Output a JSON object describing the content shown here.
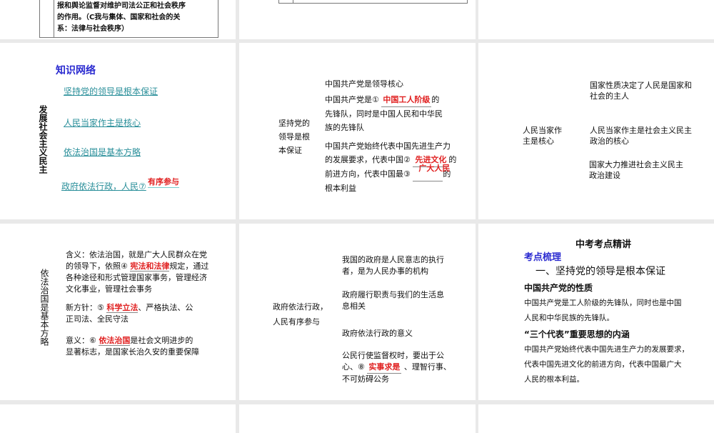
{
  "slides": {
    "s0a": {
      "lines": [
        "报和舆论监督对维护司法公正和社会秩序",
        "的作用。（C我与集体、国家和社会的关",
        "系：法律与社会秩序）"
      ]
    },
    "s1": {
      "title": "知识网络",
      "side": "发展社会主义民主",
      "links": [
        "坚持党的领导是根本保证",
        "人民当家作主是核心",
        "依法治国是基本方略",
        "政府依法行政，人民⑦"
      ],
      "answer7": "有序参与"
    },
    "s2": {
      "left": [
        "坚持党的",
        "领导是根",
        "本保证"
      ],
      "l1": "中国共产党是领导核心",
      "l2a": "中国共产党是①",
      "a1": "中国工人阶级",
      "l2b": "的",
      "l3": "先锋队，同时是中国人民和中华民",
      "l4": "族的先锋队",
      "l5": "中国共产党始终代表中国先进生产力",
      "l6a": "的发展要求，代表中国②",
      "a2": "先进文化",
      "l6b": "的",
      "l7a": "前进方向，代表中国最③",
      "a3": "广大人民",
      "l7b": "的",
      "l8": "根本利益"
    },
    "s3": {
      "left": [
        "人民当家作",
        "主是核心"
      ],
      "r1": [
        "国家性质决定了人民是国家和",
        "社会的主人"
      ],
      "r2": [
        "人民当家作主是社会主义民主",
        "政治的核心"
      ],
      "r3": [
        "国家大力推进社会主义民主",
        "政治建设"
      ]
    },
    "s4": {
      "side": "依法治国是基本方略",
      "m1": "含义：依法治国，就是广大人民群众在党",
      "m2a": "的领导下，依照④",
      "a4": "宪法和法律",
      "m2b": "规定，通过",
      "m3": "各种途径和形式管理国家事务，管理经济",
      "m4": "文化事业，管理社会事务",
      "n1a": "新方针：⑤",
      "a5": "科学立法",
      "n1b": "、严格执法、公",
      "n2": "正司法、全民守法",
      "y1a": "意义：⑥",
      "a6": "依法治国",
      "y1b": "是社会文明进步的",
      "y2": "显著标志，是国家长治久安的重要保障"
    },
    "s5": {
      "left": [
        "政府依法行政，",
        "人民有序参与"
      ],
      "r1": [
        "我国的政府是人民意志的执行",
        "者，是为人民办事的机构"
      ],
      "r2": [
        "政府履行职责与我们的生活息",
        "息相关"
      ],
      "r3": "政府依法行政的意义",
      "r4a": "公民行使监督权时，要出于公",
      "r4b": "心、⑧",
      "a8": "实事求是",
      "r4c": "、理智行事、",
      "r4d": "不可妨碍公务"
    },
    "s6": {
      "title": "中考考点精讲",
      "sub": "考点梳理",
      "heading": "一、坚持党的领导是根本保证",
      "h1": "中国共产党的性质",
      "p1": [
        "中国共产党是工人阶级的先锋队，同时也是中国",
        "人民和中华民族的先锋队。"
      ],
      "h2": "“三个代表”重要思想的内涵",
      "p2": [
        "中国共产党始终代表中国先进生产力的发展要求，",
        "代表中国先进文化的前进方向，代表中国最广大",
        "人民的根本利益。"
      ]
    }
  },
  "colors": {
    "answer": "#e02020",
    "link": "#2a8f9a",
    "heading": "#2a2ad0",
    "gap": "#e9e9e9"
  }
}
